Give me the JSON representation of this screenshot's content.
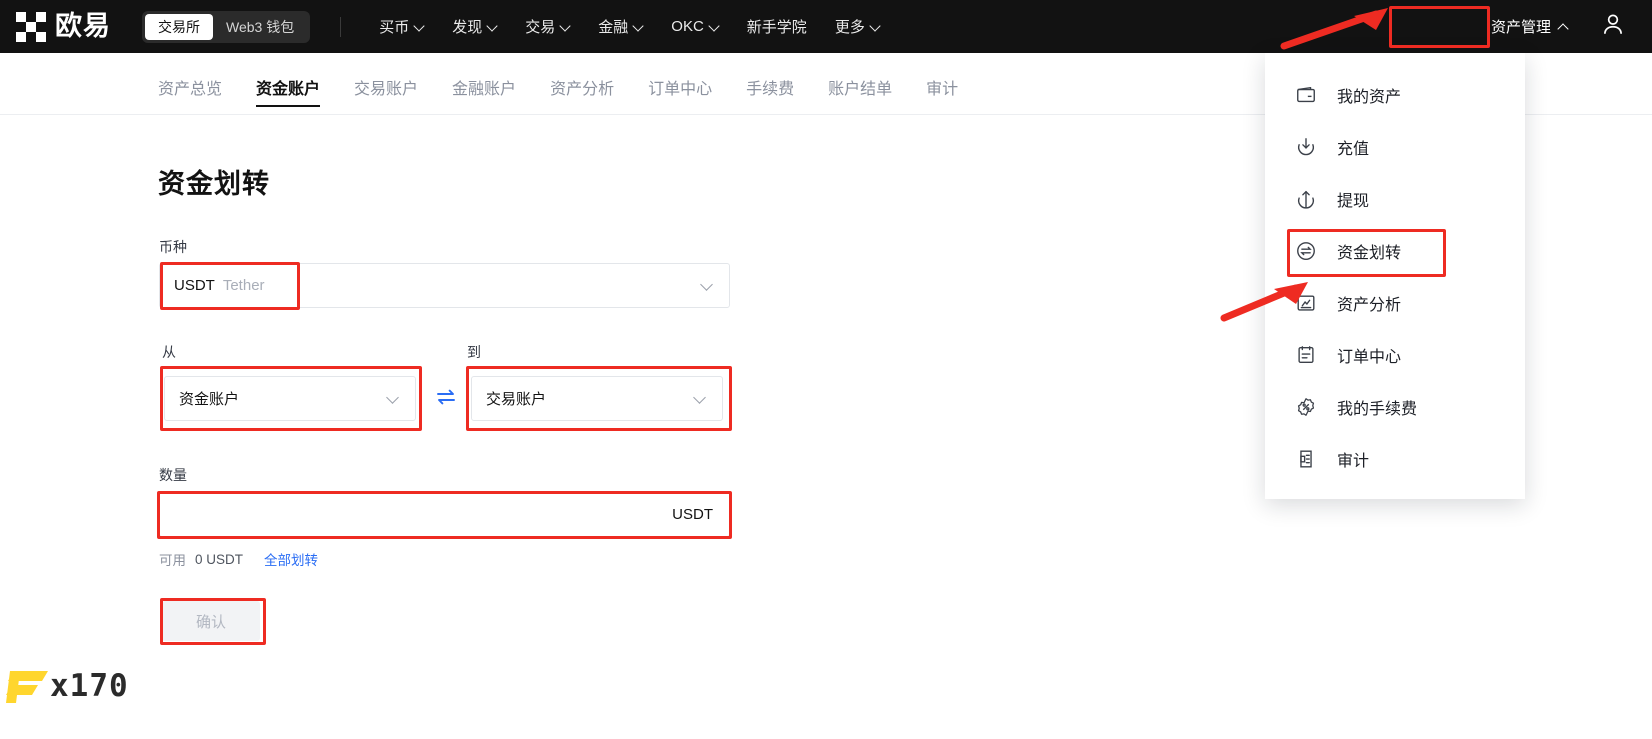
{
  "topbar": {
    "brand": "欧易",
    "brand_icon": "okx-logo-icon",
    "segments": [
      {
        "label": "交易所",
        "active": true
      },
      {
        "label": "Web3 钱包",
        "active": false
      }
    ],
    "nav": [
      {
        "label": "买币",
        "has_caret": true
      },
      {
        "label": "发现",
        "has_caret": true
      },
      {
        "label": "交易",
        "has_caret": true
      },
      {
        "label": "金融",
        "has_caret": true
      },
      {
        "label": "OKC",
        "has_caret": true
      },
      {
        "label": "新手学院",
        "has_caret": false
      },
      {
        "label": "更多",
        "has_caret": true
      }
    ],
    "asset_menu_button": {
      "label": "资产管理",
      "caret_icon": "chevron-up-icon",
      "expanded": true,
      "highlighted": true
    },
    "account_icon": "person-icon"
  },
  "tabs": [
    {
      "label": "资产总览",
      "active": false
    },
    {
      "label": "资金账户",
      "active": true
    },
    {
      "label": "交易账户",
      "active": false
    },
    {
      "label": "金融账户",
      "active": false
    },
    {
      "label": "资产分析",
      "active": false
    },
    {
      "label": "订单中心",
      "active": false
    },
    {
      "label": "手续费",
      "active": false
    },
    {
      "label": "账户结单",
      "active": false
    },
    {
      "label": "审计",
      "active": false
    }
  ],
  "form": {
    "title": "资金划转",
    "currency": {
      "label": "币种",
      "value": "USDT",
      "value_sub": "Tether",
      "chevron_icon": "chevron-down-icon"
    },
    "from": {
      "label": "从",
      "value": "资金账户",
      "chevron_icon": "chevron-down-icon"
    },
    "swap_icon": "swap-arrows-icon",
    "to": {
      "label": "到",
      "value": "交易账户",
      "chevron_icon": "chevron-down-icon"
    },
    "amount": {
      "label": "数量",
      "value": "",
      "placeholder": "",
      "suffix": "USDT"
    },
    "available": {
      "label": "可用",
      "amount": "0 USDT",
      "transfer_all": "全部划转"
    },
    "confirm_button": {
      "label": "确认",
      "disabled": true
    }
  },
  "dropdown": {
    "items": [
      {
        "label": "我的资产",
        "icon": "wallet-icon",
        "highlighted": false
      },
      {
        "label": "充值",
        "icon": "deposit-icon",
        "highlighted": false
      },
      {
        "label": "提现",
        "icon": "withdraw-icon",
        "highlighted": false
      },
      {
        "label": "资金划转",
        "icon": "transfer-icon",
        "highlighted": true
      },
      {
        "label": "资产分析",
        "icon": "analysis-icon",
        "highlighted": false
      },
      {
        "label": "订单中心",
        "icon": "order-center-icon",
        "highlighted": false
      },
      {
        "label": "我的手续费",
        "icon": "fee-badge-icon",
        "highlighted": false
      },
      {
        "label": "审计",
        "icon": "audit-icon",
        "highlighted": false
      }
    ]
  },
  "annotations": {
    "accent_color": "#ee2b22",
    "arrow_to_asset_menu": "arrow-icon",
    "arrow_to_transfer_item": "arrow-icon"
  },
  "watermark": {
    "text": "x170",
    "mark_color": "#ffd62e",
    "logo_icon": "f-mark-icon"
  }
}
